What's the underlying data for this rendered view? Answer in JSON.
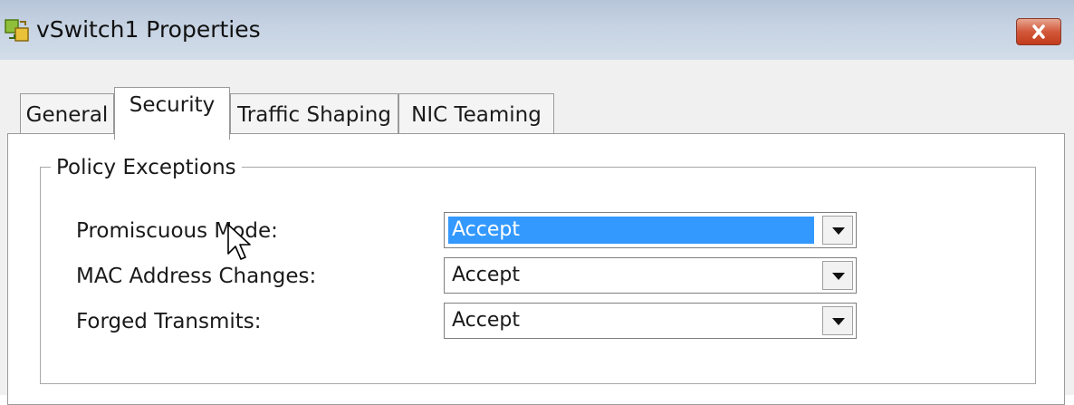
{
  "window": {
    "title": "vSwitch1 Properties"
  },
  "tabs": [
    {
      "label": "General"
    },
    {
      "label": "Security",
      "active": true
    },
    {
      "label": "Traffic Shaping"
    },
    {
      "label": "NIC Teaming"
    }
  ],
  "policy_exceptions": {
    "title": "Policy Exceptions",
    "rows": [
      {
        "label": "Promiscuous Mode:",
        "value": "Accept"
      },
      {
        "label": "MAC Address Changes:",
        "value": "Accept"
      },
      {
        "label": "Forged Transmits:",
        "value": "Accept"
      }
    ]
  },
  "colors": {
    "selection": "#3399ff",
    "titlebar": "#c6d3e3",
    "close_button": "#d2583a"
  }
}
